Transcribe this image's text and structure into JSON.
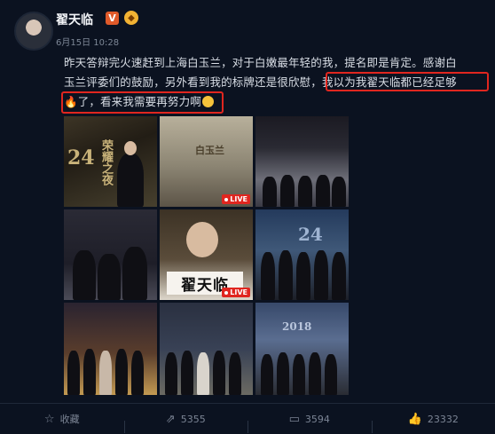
{
  "user": {
    "name": "翟天临",
    "verified_mark": "V",
    "badge_icon": "gift-badge-icon"
  },
  "post": {
    "timestamp": "6月15日 10:28",
    "lines": [
      "昨天答辩完火速赶到上海白玉兰，对于白嫩最年轻的我，提名即是肯定。感谢白",
      "玉兰评委们的鼓励，另外看到我的标牌还是很欣慰，我以为我翟天临都已经足够",
      "了，看来我需要再努力啊"
    ],
    "fire_emoji": "🔥",
    "smile_icon": "smile-emoji-icon"
  },
  "photos": {
    "p1_caption": "荣耀之夜",
    "p1_side": "24",
    "p2_caption": "白玉兰",
    "p5_sign": "翟天临",
    "p6_caption": "24",
    "p9_caption": "2018",
    "live_label": "LIVE"
  },
  "actions": {
    "favorite_label": "收藏",
    "repost_count": "5355",
    "comment_count": "3594",
    "like_count": "23332"
  },
  "colors": {
    "background": "#0b1220",
    "highlight": "#e0261f",
    "accent": "#e05a2a"
  }
}
